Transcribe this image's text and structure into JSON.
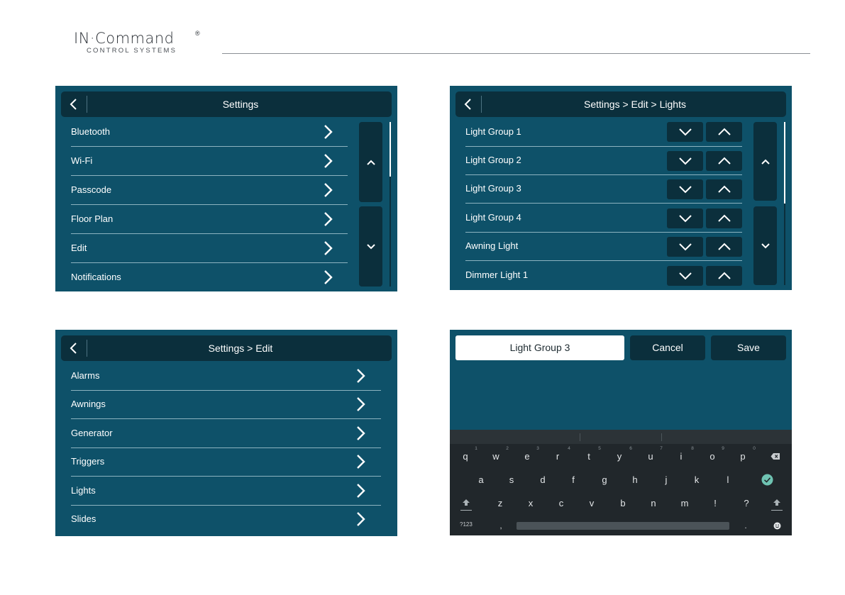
{
  "brand": {
    "name": "IN·Command",
    "registered_mark": "®",
    "tagline": "CONTROL SYSTEMS"
  },
  "screen1": {
    "title": "Settings",
    "items": [
      {
        "label": "Bluetooth"
      },
      {
        "label": "Wi-Fi"
      },
      {
        "label": "Passcode"
      },
      {
        "label": "Floor Plan"
      },
      {
        "label": "Edit"
      },
      {
        "label": "Notifications"
      }
    ]
  },
  "screen2": {
    "title": "Settings > Edit > Lights",
    "items": [
      {
        "label": "Light Group 1"
      },
      {
        "label": "Light Group 2"
      },
      {
        "label": "Light Group 3"
      },
      {
        "label": "Light Group 4"
      },
      {
        "label": "Awning Light"
      },
      {
        "label": "Dimmer Light 1"
      }
    ]
  },
  "screen3": {
    "title": "Settings > Edit",
    "items": [
      {
        "label": "Alarms"
      },
      {
        "label": "Awnings"
      },
      {
        "label": "Generator"
      },
      {
        "label": "Triggers"
      },
      {
        "label": "Lights"
      },
      {
        "label": "Slides"
      }
    ]
  },
  "screen4": {
    "name_value": "Light Group 3",
    "cancel_label": "Cancel",
    "save_label": "Save",
    "keyboard": {
      "row1": [
        "q",
        "w",
        "e",
        "r",
        "t",
        "y",
        "u",
        "i",
        "o",
        "p"
      ],
      "row1_numbers": [
        "1",
        "2",
        "3",
        "4",
        "5",
        "6",
        "7",
        "8",
        "9",
        "0"
      ],
      "row2": [
        "a",
        "s",
        "d",
        "f",
        "g",
        "h",
        "j",
        "k",
        "l"
      ],
      "row3": [
        "z",
        "x",
        "c",
        "v",
        "b",
        "n",
        "m",
        "!",
        "?"
      ],
      "symbols_label": "?123",
      "comma": ",",
      "period": "."
    }
  },
  "colors": {
    "panel": "#0e5169",
    "bar": "#0b2f3c",
    "accent_check": "#6fc3b2"
  }
}
